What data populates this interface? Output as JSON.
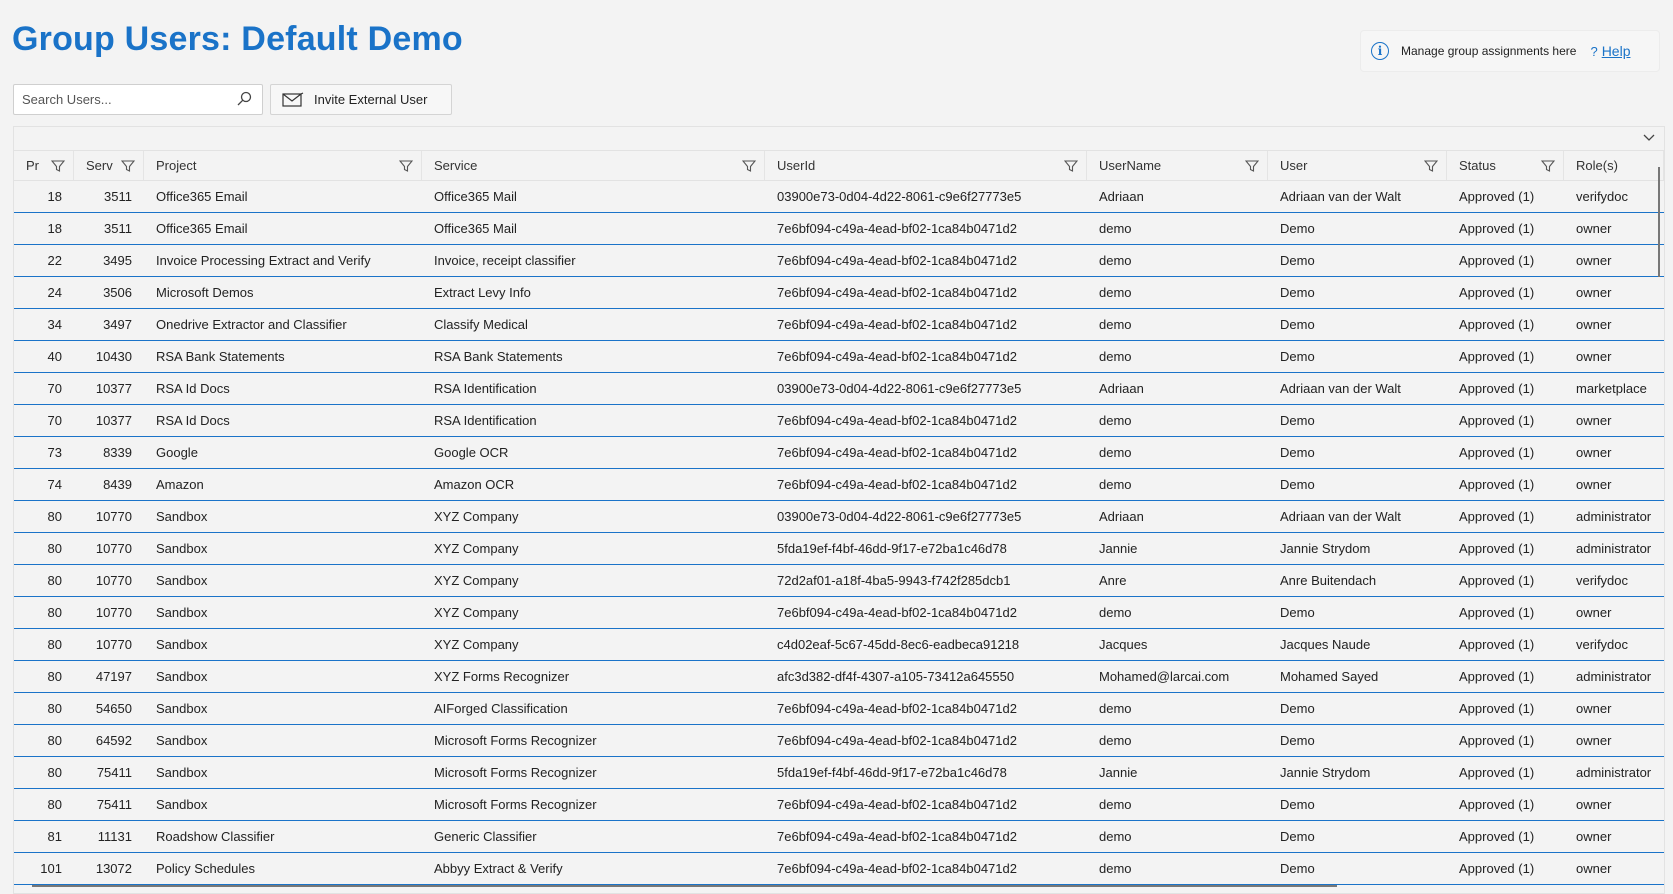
{
  "page": {
    "title": "Group Users: Default Demo"
  },
  "info": {
    "text": "Manage group assignments here",
    "help_q": "?",
    "help_label": "Help"
  },
  "search": {
    "placeholder": "Search Users...",
    "value": ""
  },
  "toolbar": {
    "invite_label": "Invite External User"
  },
  "icons": {
    "info": "info-icon",
    "help": "help-icon",
    "search": "search-icon",
    "mail": "mail-icon",
    "filter": "filter-icon",
    "collapse": "chevron-down-icon"
  },
  "colors": {
    "accent": "#1a73c8",
    "background": "#f3f3f3"
  },
  "table": {
    "columns": [
      "ProjectId",
      "ServiceId",
      "Project",
      "Service",
      "UserId",
      "UserName",
      "User",
      "Status",
      "Role(s)"
    ],
    "column_display": [
      "Pr",
      "Serv",
      "Project",
      "Service",
      "UserId",
      "UserName",
      "User",
      "Status",
      "Role(s)"
    ],
    "rows": [
      [
        "18",
        "3511",
        "Office365 Email",
        "Office365 Mail",
        "03900e73-0d04-4d22-8061-c9e6f27773e5",
        "Adriaan",
        "Adriaan van der Walt",
        "Approved (1)",
        "verifydoc"
      ],
      [
        "18",
        "3511",
        "Office365 Email",
        "Office365 Mail",
        "7e6bf094-c49a-4ead-bf02-1ca84b0471d2",
        "demo",
        "Demo",
        "Approved (1)",
        "owner"
      ],
      [
        "22",
        "3495",
        "Invoice Processing Extract and Verify",
        "Invoice, receipt classifier",
        "7e6bf094-c49a-4ead-bf02-1ca84b0471d2",
        "demo",
        "Demo",
        "Approved (1)",
        "owner"
      ],
      [
        "24",
        "3506",
        "Microsoft Demos",
        "Extract Levy Info",
        "7e6bf094-c49a-4ead-bf02-1ca84b0471d2",
        "demo",
        "Demo",
        "Approved (1)",
        "owner"
      ],
      [
        "34",
        "3497",
        "Onedrive Extractor and Classifier",
        "Classify Medical",
        "7e6bf094-c49a-4ead-bf02-1ca84b0471d2",
        "demo",
        "Demo",
        "Approved (1)",
        "owner"
      ],
      [
        "40",
        "10430",
        "RSA Bank Statements",
        "RSA Bank Statements",
        "7e6bf094-c49a-4ead-bf02-1ca84b0471d2",
        "demo",
        "Demo",
        "Approved (1)",
        "owner"
      ],
      [
        "70",
        "10377",
        "RSA Id Docs",
        "RSA Identification",
        "03900e73-0d04-4d22-8061-c9e6f27773e5",
        "Adriaan",
        "Adriaan van der Walt",
        "Approved (1)",
        "marketplace"
      ],
      [
        "70",
        "10377",
        "RSA Id Docs",
        "RSA Identification",
        "7e6bf094-c49a-4ead-bf02-1ca84b0471d2",
        "demo",
        "Demo",
        "Approved (1)",
        "owner"
      ],
      [
        "73",
        "8339",
        "Google",
        "Google OCR",
        "7e6bf094-c49a-4ead-bf02-1ca84b0471d2",
        "demo",
        "Demo",
        "Approved (1)",
        "owner"
      ],
      [
        "74",
        "8439",
        "Amazon",
        "Amazon OCR",
        "7e6bf094-c49a-4ead-bf02-1ca84b0471d2",
        "demo",
        "Demo",
        "Approved (1)",
        "owner"
      ],
      [
        "80",
        "10770",
        "Sandbox",
        "XYZ Company",
        "03900e73-0d04-4d22-8061-c9e6f27773e5",
        "Adriaan",
        "Adriaan van der Walt",
        "Approved (1)",
        "administrator"
      ],
      [
        "80",
        "10770",
        "Sandbox",
        "XYZ Company",
        "5fda19ef-f4bf-46dd-9f17-e72ba1c46d78",
        "Jannie",
        "Jannie Strydom",
        "Approved (1)",
        "administrator"
      ],
      [
        "80",
        "10770",
        "Sandbox",
        "XYZ Company",
        "72d2af01-a18f-4ba5-9943-f742f285dcb1",
        "Anre",
        "Anre Buitendach",
        "Approved (1)",
        "verifydoc"
      ],
      [
        "80",
        "10770",
        "Sandbox",
        "XYZ Company",
        "7e6bf094-c49a-4ead-bf02-1ca84b0471d2",
        "demo",
        "Demo",
        "Approved (1)",
        "owner"
      ],
      [
        "80",
        "10770",
        "Sandbox",
        "XYZ Company",
        "c4d02eaf-5c67-45dd-8ec6-eadbeca91218",
        "Jacques",
        "Jacques Naude",
        "Approved (1)",
        "verifydoc"
      ],
      [
        "80",
        "47197",
        "Sandbox",
        "XYZ Forms Recognizer",
        "afc3d382-df4f-4307-a105-73412a645550",
        "Mohamed@larcai.com",
        "Mohamed Sayed",
        "Approved (1)",
        "administrator"
      ],
      [
        "80",
        "54650",
        "Sandbox",
        "AIForged Classification",
        "7e6bf094-c49a-4ead-bf02-1ca84b0471d2",
        "demo",
        "Demo",
        "Approved (1)",
        "owner"
      ],
      [
        "80",
        "64592",
        "Sandbox",
        "Microsoft Forms Recognizer",
        "7e6bf094-c49a-4ead-bf02-1ca84b0471d2",
        "demo",
        "Demo",
        "Approved (1)",
        "owner"
      ],
      [
        "80",
        "75411",
        "Sandbox",
        "Microsoft Forms Recognizer",
        "5fda19ef-f4bf-46dd-9f17-e72ba1c46d78",
        "Jannie",
        "Jannie Strydom",
        "Approved (1)",
        "administrator"
      ],
      [
        "80",
        "75411",
        "Sandbox",
        "Microsoft Forms Recognizer",
        "7e6bf094-c49a-4ead-bf02-1ca84b0471d2",
        "demo",
        "Demo",
        "Approved (1)",
        "owner"
      ],
      [
        "81",
        "11131",
        "Roadshow Classifier",
        "Generic Classifier",
        "7e6bf094-c49a-4ead-bf02-1ca84b0471d2",
        "demo",
        "Demo",
        "Approved (1)",
        "owner"
      ],
      [
        "101",
        "13072",
        "Policy Schedules",
        "Abbyy Extract & Verify",
        "7e6bf094-c49a-4ead-bf02-1ca84b0471d2",
        "demo",
        "Demo",
        "Approved (1)",
        "owner"
      ]
    ]
  }
}
